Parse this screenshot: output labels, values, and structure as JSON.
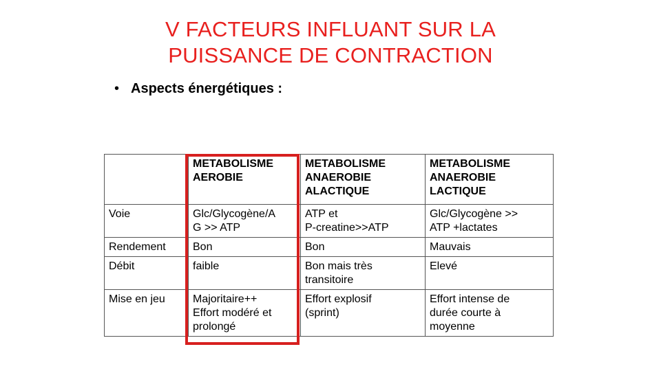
{
  "title": {
    "line1": "V FACTEURS INFLUANT SUR LA",
    "line2": "PUISSANCE DE CONTRACTION"
  },
  "bullet": {
    "marker": "•",
    "text": "Aspects énergétiques :"
  },
  "table": {
    "headers": [
      "",
      "METABOLISME AEROBIE",
      "METABOLISME ANAEROBIE ALACTIQUE",
      "METABOLISME ANAEROBIE LACTIQUE"
    ],
    "rows": [
      {
        "label": "Voie",
        "cells": [
          [
            "Glc/Glycogène/A",
            "G >> ATP"
          ],
          [
            "ATP et",
            "P-creatine>>ATP"
          ],
          [
            "Glc/Glycogène >>",
            "ATP +lactates"
          ]
        ]
      },
      {
        "label": "Rendement",
        "cells": [
          [
            "Bon"
          ],
          [
            "Bon"
          ],
          [
            "Mauvais"
          ]
        ]
      },
      {
        "label": "Débit",
        "cells": [
          [
            "faible"
          ],
          [
            "Bon mais très",
            "transitoire"
          ],
          [
            "Elevé"
          ]
        ]
      },
      {
        "label": "Mise en jeu",
        "cells": [
          [
            "Majoritaire++",
            "Effort modéré et",
            "prolongé"
          ],
          [
            "Effort explosif",
            "(sprint)"
          ],
          [
            "Effort intense de",
            "durée courte à",
            "moyenne"
          ]
        ]
      }
    ]
  },
  "colors": {
    "title": "#e8201e",
    "highlight_border": "#d7201f",
    "grid_line": "#555555"
  }
}
